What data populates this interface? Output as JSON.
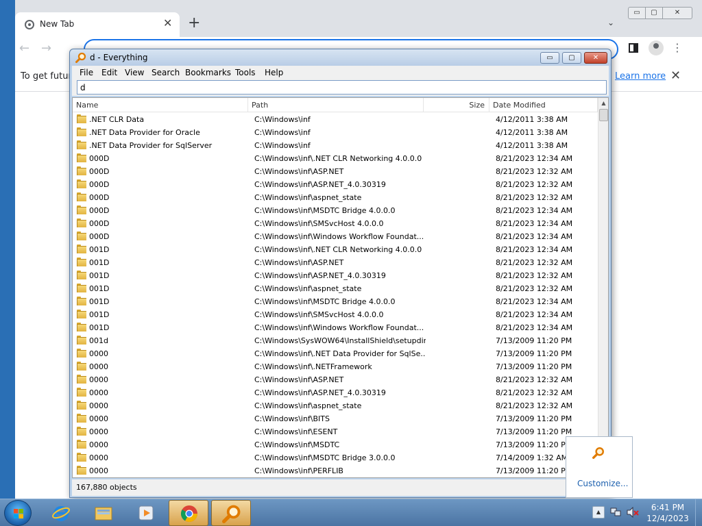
{
  "chrome": {
    "tab_title": "New Tab",
    "tab_close": "✕",
    "new_tab": "+",
    "tab_list": "⌄",
    "min": "▭",
    "max": "▢",
    "close": "✕",
    "back": "←",
    "forward": "→",
    "infobar_text": "To get future",
    "learn_more": "Learn more",
    "infobar_close": "✕",
    "menu": "⋮"
  },
  "everything": {
    "title": "d - Everything",
    "controls": {
      "min": "▭",
      "max": "▢",
      "close": "✕"
    },
    "menu": [
      "File",
      "Edit",
      "View",
      "Search",
      "Bookmarks",
      "Tools",
      "Help"
    ],
    "search_value": "d",
    "columns": {
      "name": "Name",
      "path": "Path",
      "size": "Size",
      "date": "Date Modified"
    },
    "rows": [
      {
        "name": ".NET CLR Data",
        "path": "C:\\Windows\\inf",
        "date": "4/12/2011 3:38 AM"
      },
      {
        "name": ".NET Data Provider for Oracle",
        "path": "C:\\Windows\\inf",
        "date": "4/12/2011 3:38 AM"
      },
      {
        "name": ".NET Data Provider for SqlServer",
        "path": "C:\\Windows\\inf",
        "date": "4/12/2011 3:38 AM"
      },
      {
        "name": "000D",
        "path": "C:\\Windows\\inf\\.NET CLR Networking 4.0.0.0",
        "date": "8/21/2023 12:34 AM"
      },
      {
        "name": "000D",
        "path": "C:\\Windows\\inf\\ASP.NET",
        "date": "8/21/2023 12:32 AM"
      },
      {
        "name": "000D",
        "path": "C:\\Windows\\inf\\ASP.NET_4.0.30319",
        "date": "8/21/2023 12:32 AM"
      },
      {
        "name": "000D",
        "path": "C:\\Windows\\inf\\aspnet_state",
        "date": "8/21/2023 12:32 AM"
      },
      {
        "name": "000D",
        "path": "C:\\Windows\\inf\\MSDTC Bridge 4.0.0.0",
        "date": "8/21/2023 12:34 AM"
      },
      {
        "name": "000D",
        "path": "C:\\Windows\\inf\\SMSvcHost 4.0.0.0",
        "date": "8/21/2023 12:34 AM"
      },
      {
        "name": "000D",
        "path": "C:\\Windows\\inf\\Windows Workflow Foundat...",
        "date": "8/21/2023 12:34 AM"
      },
      {
        "name": "001D",
        "path": "C:\\Windows\\inf\\.NET CLR Networking 4.0.0.0",
        "date": "8/21/2023 12:34 AM"
      },
      {
        "name": "001D",
        "path": "C:\\Windows\\inf\\ASP.NET",
        "date": "8/21/2023 12:32 AM"
      },
      {
        "name": "001D",
        "path": "C:\\Windows\\inf\\ASP.NET_4.0.30319",
        "date": "8/21/2023 12:32 AM"
      },
      {
        "name": "001D",
        "path": "C:\\Windows\\inf\\aspnet_state",
        "date": "8/21/2023 12:32 AM"
      },
      {
        "name": "001D",
        "path": "C:\\Windows\\inf\\MSDTC Bridge 4.0.0.0",
        "date": "8/21/2023 12:34 AM"
      },
      {
        "name": "001D",
        "path": "C:\\Windows\\inf\\SMSvcHost 4.0.0.0",
        "date": "8/21/2023 12:34 AM"
      },
      {
        "name": "001D",
        "path": "C:\\Windows\\inf\\Windows Workflow Foundat...",
        "date": "8/21/2023 12:34 AM"
      },
      {
        "name": "001d",
        "path": "C:\\Windows\\SysWOW64\\InstallShield\\setupdir",
        "date": "7/13/2009 11:20 PM"
      },
      {
        "name": "0000",
        "path": "C:\\Windows\\inf\\.NET Data Provider for SqlSe...",
        "date": "7/13/2009 11:20 PM"
      },
      {
        "name": "0000",
        "path": "C:\\Windows\\inf\\.NETFramework",
        "date": "7/13/2009 11:20 PM"
      },
      {
        "name": "0000",
        "path": "C:\\Windows\\inf\\ASP.NET",
        "date": "8/21/2023 12:32 AM"
      },
      {
        "name": "0000",
        "path": "C:\\Windows\\inf\\ASP.NET_4.0.30319",
        "date": "8/21/2023 12:32 AM"
      },
      {
        "name": "0000",
        "path": "C:\\Windows\\inf\\aspnet_state",
        "date": "8/21/2023 12:32 AM"
      },
      {
        "name": "0000",
        "path": "C:\\Windows\\inf\\BITS",
        "date": "7/13/2009 11:20 PM"
      },
      {
        "name": "0000",
        "path": "C:\\Windows\\inf\\ESENT",
        "date": "7/13/2009 11:20 PM"
      },
      {
        "name": "0000",
        "path": "C:\\Windows\\inf\\MSDTC",
        "date": "7/13/2009 11:20 PM"
      },
      {
        "name": "0000",
        "path": "C:\\Windows\\inf\\MSDTC Bridge 3.0.0.0",
        "date": "7/14/2009 1:32 AM"
      },
      {
        "name": "0000",
        "path": "C:\\Windows\\inf\\PERFLIB",
        "date": "7/13/2009 11:20 PM"
      }
    ],
    "status": "167,880 objects"
  },
  "tray_popup": {
    "customize": "Customize..."
  },
  "taskbar": {
    "time": "6:41 PM",
    "date": "12/4/2023",
    "tray_arrow": "▲"
  },
  "colors": {
    "desktop": "#1a5796",
    "chrome_accent": "#1a73e8",
    "everything_frame": "#bcd3ec",
    "taskbar": "#4b74a3"
  }
}
